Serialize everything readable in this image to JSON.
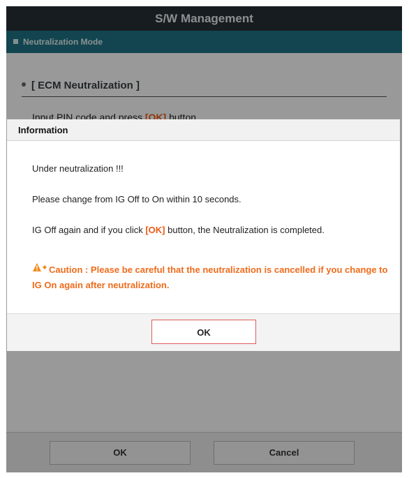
{
  "window": {
    "title": "S/W Management"
  },
  "section": {
    "label": "Neutralization Mode"
  },
  "background": {
    "ecm_title": "[ ECM Neutralization ]",
    "pin_text_before": "Input PIN code and press ",
    "pin_text_ok": "[OK]",
    "pin_text_after": " button."
  },
  "bottom_buttons": {
    "ok_label": "OK",
    "cancel_label": "Cancel"
  },
  "dialog": {
    "title": "Information",
    "line1": "Under neutralization !!!",
    "line2": "Please change from IG Off to On within 10 seconds.",
    "line3_before": "IG Off again and if you click ",
    "line3_ok": "[OK]",
    "line3_after": " button, the Neutralization is completed.",
    "caution_text": "Caution : Please be careful that the neutralization is cancelled if you change to IG On again after neutralization.",
    "ok_label": "OK"
  },
  "colors": {
    "title_bar": "#272f36",
    "section_bar": "#1f7384",
    "highlight_orange": "#ef5a17",
    "caution_orange": "#ef6b1b",
    "ok_button_border": "#e05a5a"
  },
  "icons": {
    "caution": "warning-triangle-icon"
  }
}
